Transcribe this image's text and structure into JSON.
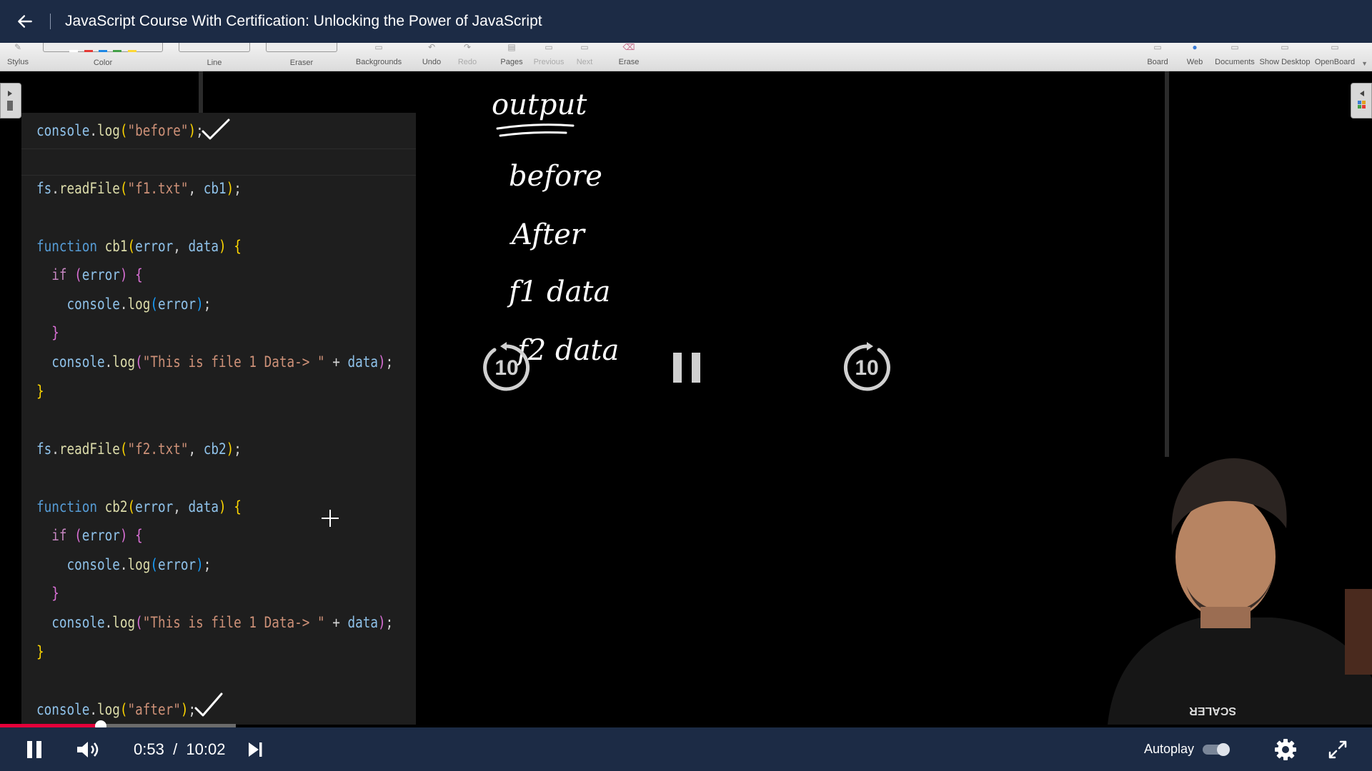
{
  "header": {
    "title": "JavaScript Course With Certification: Unlocking the Power of JavaScript",
    "back_icon": "arrow-left-icon"
  },
  "toolbar": {
    "left_items": [
      "Stylus",
      "Color",
      "Line",
      "Eraser",
      "Backgrounds",
      "Undo",
      "Redo",
      "Pages",
      "Previous",
      "Next",
      "Erase"
    ],
    "right_items": [
      "Board",
      "Web",
      "Documents",
      "Show Desktop",
      "OpenBoard"
    ],
    "palette_colors": [
      "#ffffff",
      "#e53935",
      "#1e88e5",
      "#43a047",
      "#fdd835"
    ]
  },
  "code": {
    "lines": [
      [
        "console.log(\"before\");"
      ],
      [
        "fs.readFile(\"f1.txt\", cb1);"
      ],
      [
        "function cb1(error, data) {"
      ],
      [
        "  if (error) {"
      ],
      [
        "    console.log(error);"
      ],
      [
        "  }"
      ],
      [
        "  console.log(\"This is file 1 Data-> \" + data);"
      ],
      [
        "}"
      ],
      [
        "fs.readFile(\"f2.txt\", cb2);"
      ],
      [
        "function cb2(error, data) {"
      ],
      [
        "  if (error) {"
      ],
      [
        "    console.log(error);"
      ],
      [
        "  }"
      ],
      [
        "  console.log(\"This is file 1 Data-> \" + data);"
      ],
      [
        "}"
      ],
      [
        "console.log(\"after\");"
      ]
    ]
  },
  "whiteboard": {
    "heading": "output",
    "items": [
      "before",
      "After",
      "f1 data",
      "f2 data"
    ]
  },
  "overlay": {
    "rewind_seconds": "10",
    "forward_seconds": "10"
  },
  "player": {
    "current_time": "0:53",
    "separator": "/",
    "duration": "10:02",
    "progress_fraction": 0.088,
    "buffered_fraction": 0.206,
    "autoplay_label": "Autoplay",
    "autoplay_on": false
  },
  "colors": {
    "header_bg": "#1c2b45",
    "progress": "#e4003a"
  }
}
